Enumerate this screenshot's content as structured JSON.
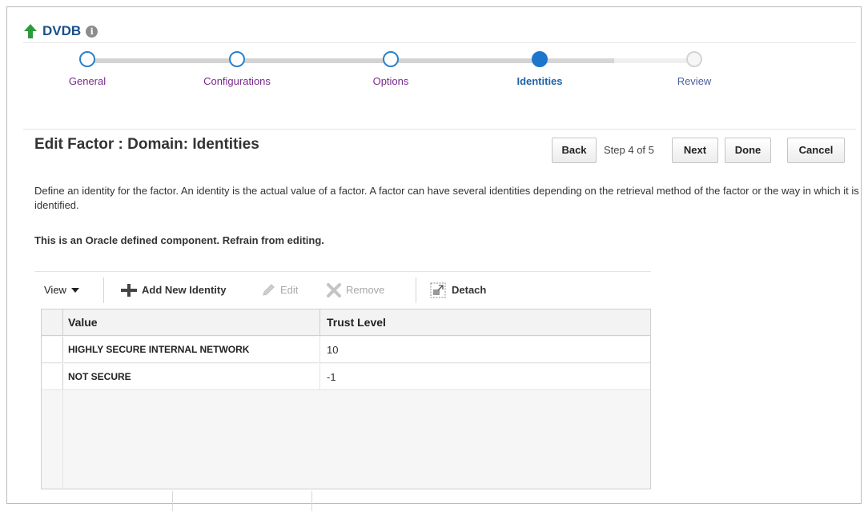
{
  "header": {
    "title": "DVDB",
    "info_icon": "info-icon",
    "back_icon": "up-arrow-icon"
  },
  "train": {
    "steps": [
      {
        "label": "General",
        "state": "visited"
      },
      {
        "label": "Configurations",
        "state": "visited"
      },
      {
        "label": "Options",
        "state": "visited"
      },
      {
        "label": "Identities",
        "state": "current"
      },
      {
        "label": "Review",
        "state": "future"
      }
    ]
  },
  "page": {
    "title": "Edit Factor : Domain: Identities",
    "buttons": {
      "back": "Back",
      "step": "Step 4 of 5",
      "next": "Next",
      "done": "Done",
      "cancel": "Cancel"
    },
    "description": "Define an identity for the factor. An identity is the actual value of a factor. A factor can have several identities depending on the retrieval method of the factor or the way in which it is identified.",
    "warning": "This is an Oracle defined component. Refrain from editing."
  },
  "toolbar": {
    "view": "View",
    "add": "Add New Identity",
    "edit": "Edit",
    "remove": "Remove",
    "detach": "Detach"
  },
  "table": {
    "headers": [
      "Value",
      "Trust Level"
    ],
    "rows": [
      [
        "HIGHLY SECURE INTERNAL NETWORK",
        "10"
      ],
      [
        "NOT SECURE",
        "-1"
      ]
    ]
  },
  "colors": {
    "accent": "#1e76cc",
    "visited_label": "#7a2a8c",
    "title": "#1b4f8a",
    "add_icon": "#2e9a3c"
  }
}
